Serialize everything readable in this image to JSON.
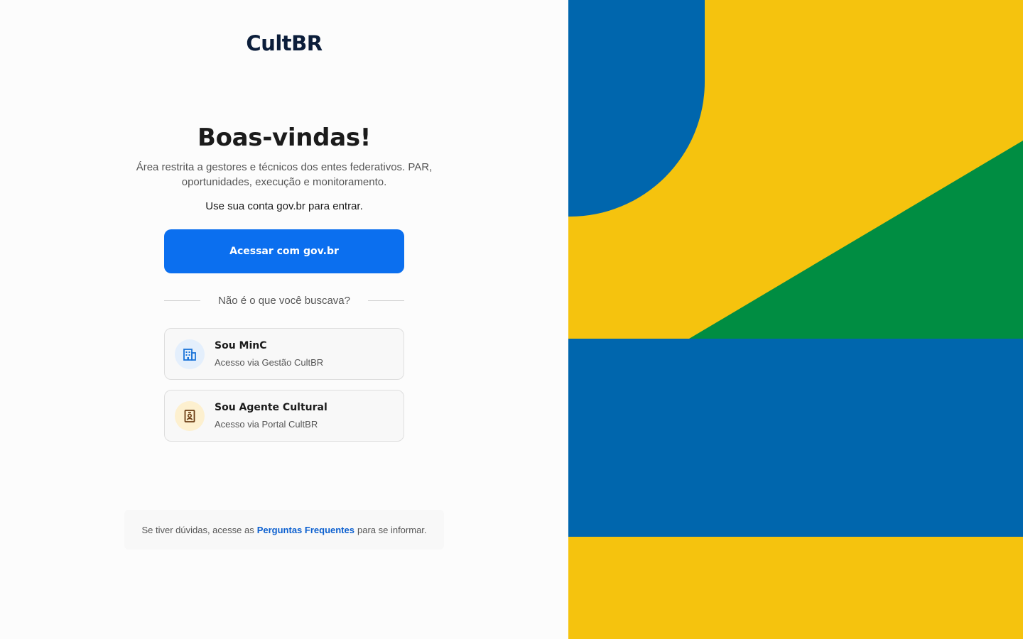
{
  "brand": {
    "logo": "CultBR"
  },
  "welcome": {
    "title": "Boas-vindas!",
    "subtitle": "Área restrita a gestores e técnicos dos entes federativos. PAR, oportunidades, execução e monitoramento.",
    "instruction": "Use sua conta gov.br para entrar."
  },
  "login": {
    "govbr_button": "Acessar com gov.br"
  },
  "divider": {
    "text": "Não é o que você buscava?"
  },
  "options": [
    {
      "title": "Sou MinC",
      "subtitle": "Acesso via Gestão CultBR",
      "icon": "building-icon"
    },
    {
      "title": "Sou Agente Cultural",
      "subtitle": "Acesso via Portal CultBR",
      "icon": "id-badge-icon"
    }
  ],
  "help": {
    "prefix": "Se tiver dúvidas, acesse as",
    "link": "Perguntas Frequentes",
    "suffix": "para se informar."
  },
  "colors": {
    "primary": "#0b6fef",
    "brand_blue": "#0066ad",
    "brand_yellow": "#f5c30e",
    "brand_green": "#008d42"
  }
}
